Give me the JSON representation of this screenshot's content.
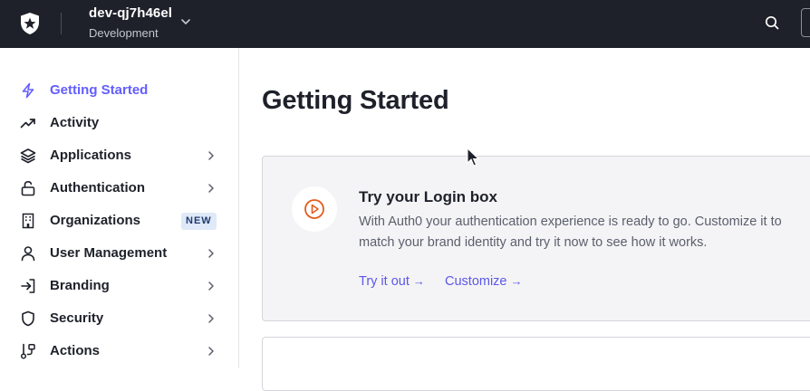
{
  "topbar": {
    "logo_icon": "auth0-shield-star-icon",
    "tenant_name": "dev-qj7h46el",
    "tenant_environment": "Development",
    "search_icon": "search-icon"
  },
  "sidebar": {
    "items": [
      {
        "label": "Getting Started",
        "icon": "lightning-icon",
        "active": true,
        "chevron": false,
        "badge": ""
      },
      {
        "label": "Activity",
        "icon": "trending-up-icon",
        "active": false,
        "chevron": false,
        "badge": ""
      },
      {
        "label": "Applications",
        "icon": "layers-icon",
        "active": false,
        "chevron": true,
        "badge": ""
      },
      {
        "label": "Authentication",
        "icon": "unlock-icon",
        "active": false,
        "chevron": true,
        "badge": ""
      },
      {
        "label": "Organizations",
        "icon": "building-icon",
        "active": false,
        "chevron": false,
        "badge": "NEW"
      },
      {
        "label": "User Management",
        "icon": "user-icon",
        "active": false,
        "chevron": true,
        "badge": ""
      },
      {
        "label": "Branding",
        "icon": "sign-in-icon",
        "active": false,
        "chevron": true,
        "badge": ""
      },
      {
        "label": "Security",
        "icon": "shield-icon",
        "active": false,
        "chevron": true,
        "badge": ""
      },
      {
        "label": "Actions",
        "icon": "actions-flow-icon",
        "active": false,
        "chevron": true,
        "badge": ""
      }
    ]
  },
  "main": {
    "title": "Getting Started",
    "card": {
      "icon": "play-circle-icon",
      "title": "Try your Login box",
      "description": "With Auth0 your authentication experience is ready to go. Customize it to match your brand identity and try it now to see how it works.",
      "links": [
        {
          "label": "Try it out",
          "arrow": "→"
        },
        {
          "label": "Customize",
          "arrow": "→"
        }
      ]
    }
  },
  "colors": {
    "topbar_bg": "#1e212a",
    "accent": "#635dff",
    "card_bg": "#f4f4f6",
    "badge_bg": "#dfe9f7"
  }
}
